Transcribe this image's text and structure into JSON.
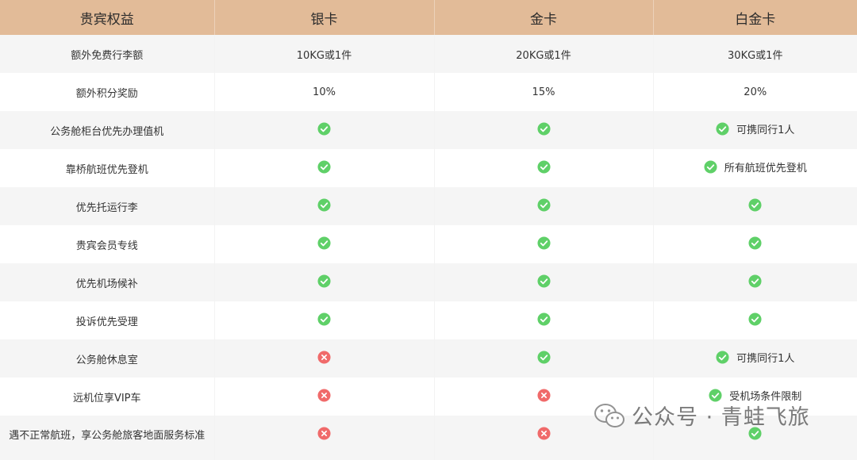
{
  "header": {
    "col0": "贵宾权益",
    "col1": "银卡",
    "col2": "金卡",
    "col3": "白金卡"
  },
  "rows": [
    {
      "benefit": "额外免费行李额",
      "silver": {
        "text": "10KG或1件"
      },
      "gold": {
        "text": "20KG或1件"
      },
      "platinum": {
        "text": "30KG或1件"
      }
    },
    {
      "benefit": "额外积分奖励",
      "silver": {
        "text": "10%"
      },
      "gold": {
        "text": "15%"
      },
      "platinum": {
        "text": "20%"
      }
    },
    {
      "benefit": "公务舱柜台优先办理值机",
      "silver": {
        "icon": "check"
      },
      "gold": {
        "icon": "check"
      },
      "platinum": {
        "icon": "check",
        "note": "可携同行1人"
      }
    },
    {
      "benefit": "靠桥航班优先登机",
      "silver": {
        "icon": "check"
      },
      "gold": {
        "icon": "check"
      },
      "platinum": {
        "icon": "check",
        "note": "所有航班优先登机"
      }
    },
    {
      "benefit": "优先托运行李",
      "silver": {
        "icon": "check"
      },
      "gold": {
        "icon": "check"
      },
      "platinum": {
        "icon": "check"
      }
    },
    {
      "benefit": "贵宾会员专线",
      "silver": {
        "icon": "check"
      },
      "gold": {
        "icon": "check"
      },
      "platinum": {
        "icon": "check"
      }
    },
    {
      "benefit": "优先机场候补",
      "silver": {
        "icon": "check"
      },
      "gold": {
        "icon": "check"
      },
      "platinum": {
        "icon": "check"
      }
    },
    {
      "benefit": "投诉优先受理",
      "silver": {
        "icon": "check"
      },
      "gold": {
        "icon": "check"
      },
      "platinum": {
        "icon": "check"
      }
    },
    {
      "benefit": "公务舱休息室",
      "silver": {
        "icon": "cross"
      },
      "gold": {
        "icon": "check"
      },
      "platinum": {
        "icon": "check",
        "note": "可携同行1人"
      }
    },
    {
      "benefit": "远机位享VIP车",
      "silver": {
        "icon": "cross"
      },
      "gold": {
        "icon": "cross"
      },
      "platinum": {
        "icon": "check",
        "note": "受机场条件限制"
      }
    },
    {
      "benefit": "遇不正常航班，享公务舱旅客地面服务标准",
      "silver": {
        "icon": "cross"
      },
      "gold": {
        "icon": "cross"
      },
      "platinum": {
        "icon": "check"
      }
    }
  ],
  "watermark": {
    "icon": "wechat-icon",
    "text": "公众号 · 青蛙飞旅"
  },
  "colors": {
    "header_bg": "#e2bb98",
    "row_alt_bg": "#f5f5f5",
    "check": "#5fd068",
    "cross": "#f06a6a"
  }
}
